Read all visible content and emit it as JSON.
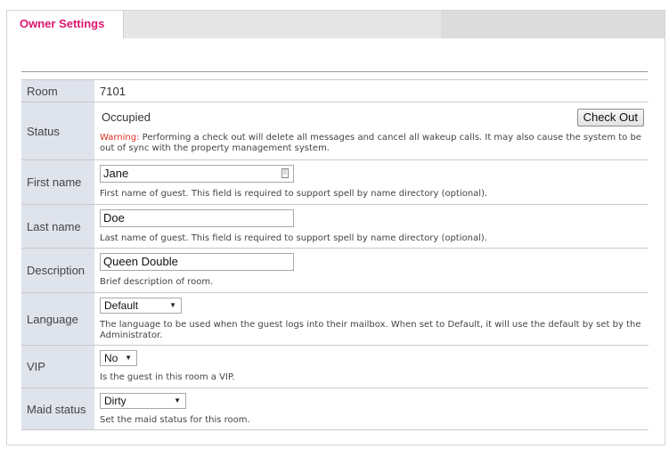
{
  "tab": {
    "label": "Owner Settings"
  },
  "room": {
    "label": "Room",
    "value": "7101"
  },
  "status": {
    "label": "Status",
    "value": "Occupied",
    "checkout_label": "Check Out",
    "warning_prefix": "Warning:",
    "warning_text": " Performing a check out will delete all messages and cancel all wakeup calls. It may also cause the system to be out of sync with the property management system."
  },
  "first_name": {
    "label": "First name",
    "value": "Jane",
    "help": "First name of guest. This field is required to support spell by name directory (optional)."
  },
  "last_name": {
    "label": "Last name",
    "value": "Doe",
    "help": "Last name of guest. This field is required to support spell by name directory (optional)."
  },
  "description": {
    "label": "Description",
    "value": "Queen Double",
    "help": "Brief description of room."
  },
  "language": {
    "label": "Language",
    "selected": "Default",
    "help": "The language to be used when the guest logs into their mailbox. When set to Default, it will use the default by set by the Administrator."
  },
  "vip": {
    "label": "VIP",
    "selected": "No",
    "help": "Is the guest in this room a VIP."
  },
  "maid_status": {
    "label": "Maid status",
    "selected": "Dirty",
    "help": "Set the maid status for this room."
  },
  "icons": {
    "dropdown": "chevron-down-icon",
    "input_helper": "keyboard-icon"
  }
}
